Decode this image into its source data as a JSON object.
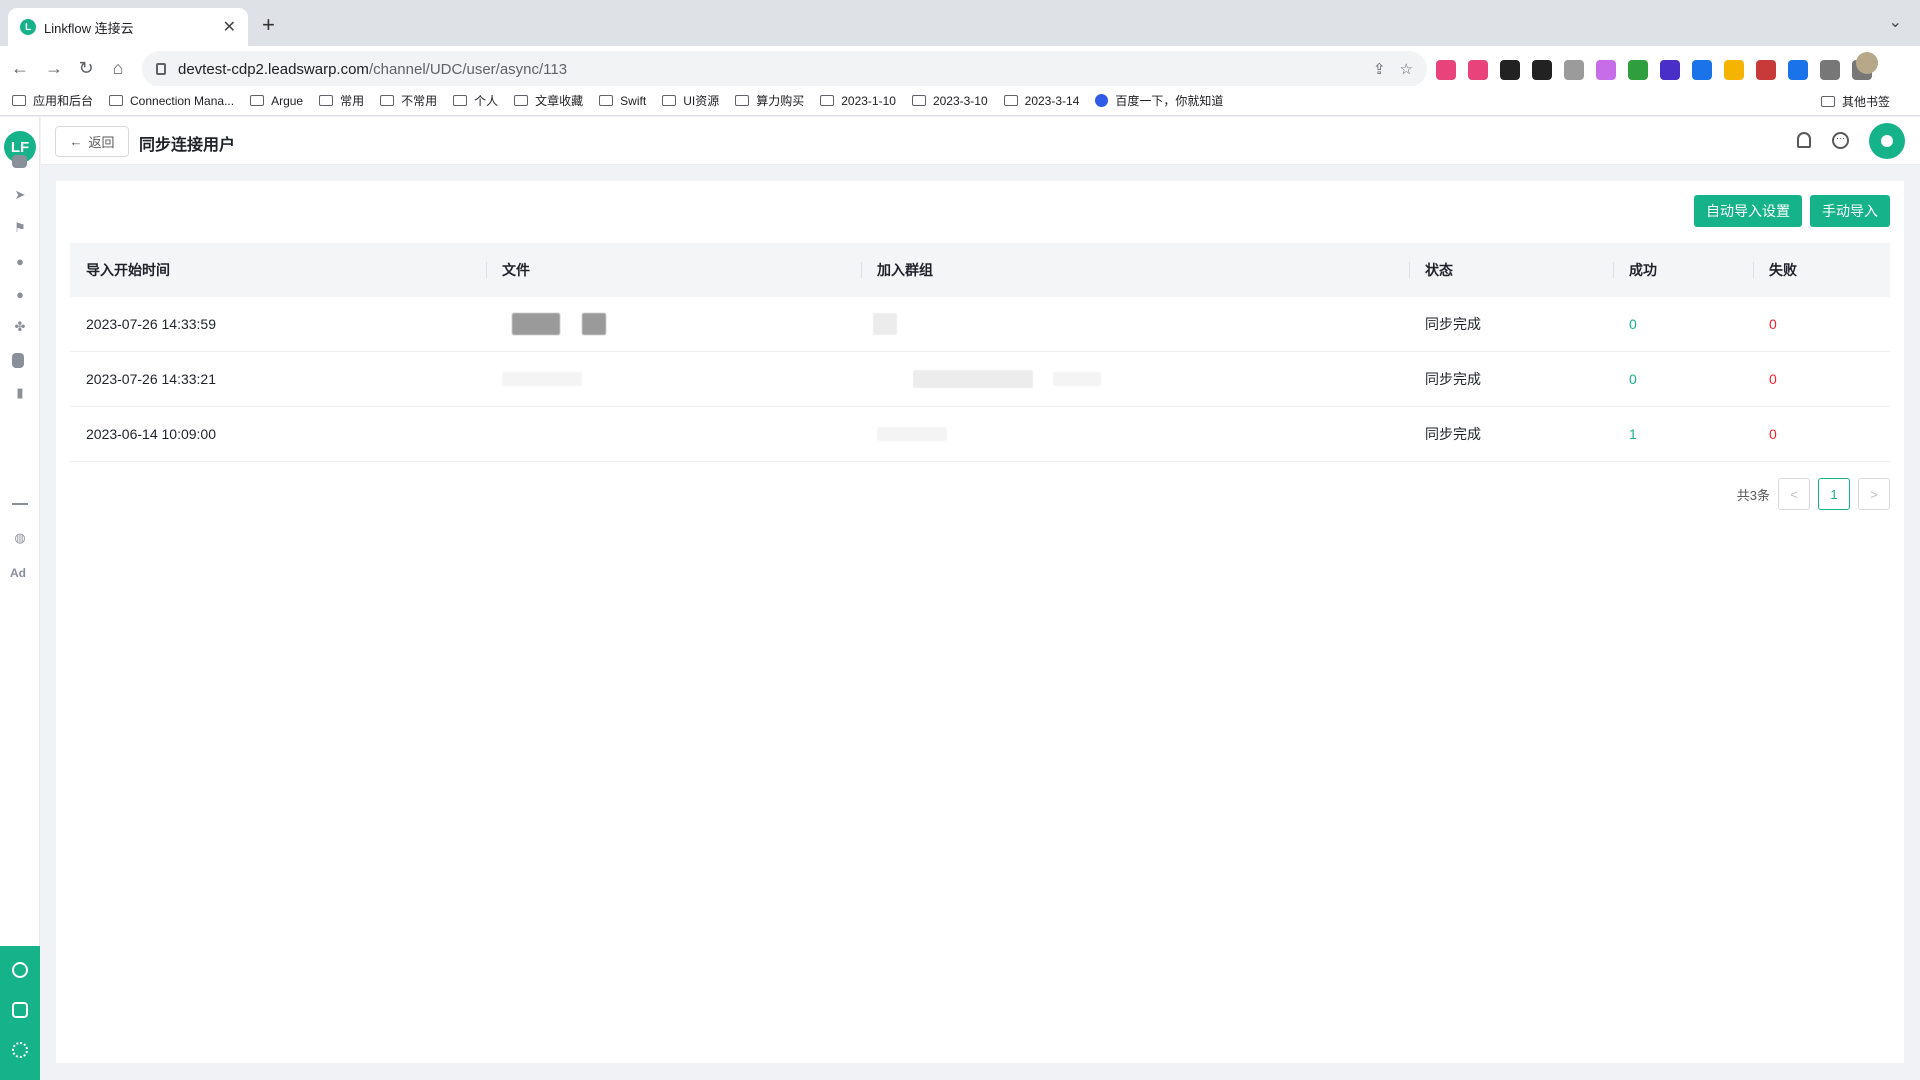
{
  "browser": {
    "tab_title": "Linkflow 连接云",
    "tab_close": "✕",
    "new_tab": "+",
    "tab_menu": "⌄",
    "url_host": "devtest-cdp2.leadswarp.com",
    "url_path": "/channel/UDC/user/async/113",
    "nav": {
      "back": "←",
      "forward": "→",
      "reload": "↻",
      "home": "⌂"
    },
    "bookmarks": [
      "应用和后台",
      "Connection Mana...",
      "Argue",
      "常用",
      "不常用",
      "个人",
      "文章收藏",
      "Swift",
      "UI资源",
      "算力购买",
      "2023-1-10",
      "2023-3-10",
      "2023-3-14"
    ],
    "bookmark_baidu": "百度一下，你就知道",
    "bookmark_other": "其他书签",
    "extension_colors": [
      "#e8437a",
      "#e8437a",
      "#222222",
      "#222222",
      "#9b9b9b",
      "#c86de8",
      "#2e9e3e",
      "#4a2ec8",
      "#1a73e8",
      "#f5b400",
      "#c83a3a",
      "#1a73e8",
      "#777777",
      "#777777"
    ]
  },
  "app": {
    "logo": "LF",
    "back_label": "返回",
    "back_arrow": "←",
    "page_title": "同步连接用户",
    "sidebar_ad": "Ad",
    "chat_glyph": "···",
    "accent_color": "#16b38a",
    "fail_color": "#f5222d"
  },
  "actions": {
    "auto_import": "自动导入设置",
    "manual_import": "手动导入"
  },
  "table": {
    "columns": [
      "导入开始时间",
      "文件",
      "加入群组",
      "状态",
      "成功",
      "失败"
    ],
    "rows": [
      {
        "time": "2023-07-26 14:33:59",
        "status": "同步完成",
        "success": "0",
        "fail": "0"
      },
      {
        "time": "2023-07-26 14:33:21",
        "status": "同步完成",
        "success": "0",
        "fail": "0"
      },
      {
        "time": "2023-06-14 10:09:00",
        "status": "同步完成",
        "success": "1",
        "fail": "0"
      }
    ]
  },
  "pagination": {
    "total": "共3条",
    "prev": "<",
    "current": "1",
    "next": ">"
  }
}
